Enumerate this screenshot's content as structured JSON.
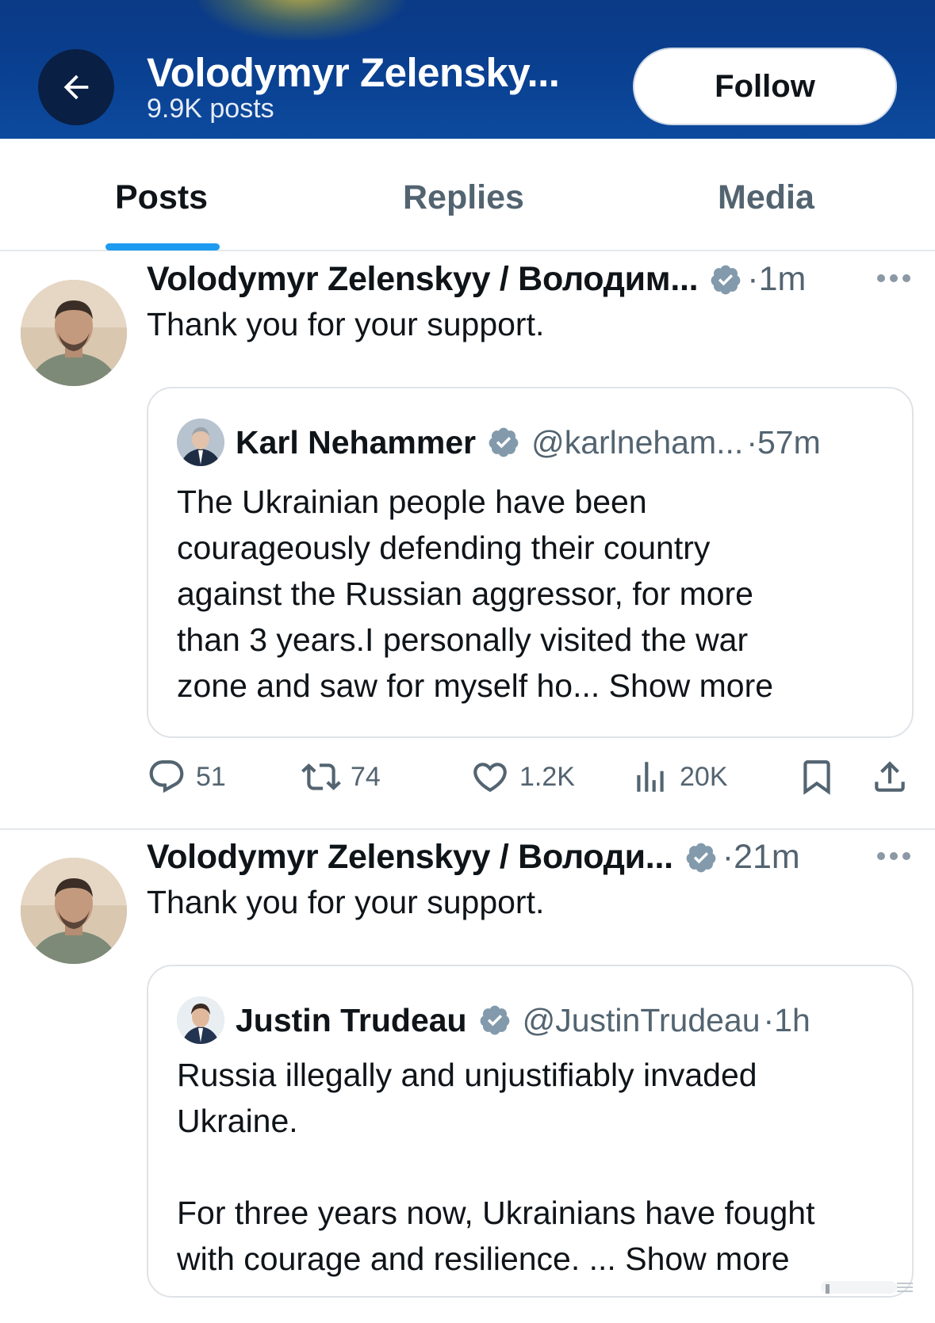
{
  "header": {
    "profile_name": "Volodymyr Zelensky...",
    "post_count": "9.9K posts",
    "follow_label": "Follow",
    "back_icon": "arrow-left-icon"
  },
  "tabs": [
    {
      "label": "Posts",
      "active": true
    },
    {
      "label": "Replies",
      "active": false
    },
    {
      "label": "Media",
      "active": false
    }
  ],
  "colors": {
    "header_bg": "#0b3a86",
    "accent": "#1d9bf0",
    "verified": "#829aab",
    "secondary_text": "#536471"
  },
  "posts": [
    {
      "author": "Volodymyr Zelenskyy / Володим...",
      "time": "·1m",
      "text": "Thank you for your support.",
      "quote": {
        "author": "Karl Nehammer",
        "handle": "@karlneham...",
        "time": "·57m",
        "lines": [
          "The Ukrainian people have been",
          "courageously defending their country",
          "against the Russian aggressor, for more",
          "than 3 years.I personally visited the war"
        ],
        "last_line": "zone and saw for myself ho...",
        "show_more": "Show more"
      },
      "actions": {
        "replies": "51",
        "reposts": "74",
        "likes": "1.2K",
        "views": "20K"
      }
    },
    {
      "author": "Volodymyr Zelenskyy / Володи...",
      "time": "·21m",
      "text": "Thank you for your support.",
      "quote": {
        "author": "Justin Trudeau",
        "handle": "@JustinTrudeau",
        "time": "·1h",
        "lines": [
          "Russia illegally and unjustifiably invaded",
          "Ukraine.",
          "",
          "For three years now, Ukrainians have fought"
        ],
        "last_line": "with courage and resilience. ...",
        "show_more": "Show more"
      }
    }
  ]
}
